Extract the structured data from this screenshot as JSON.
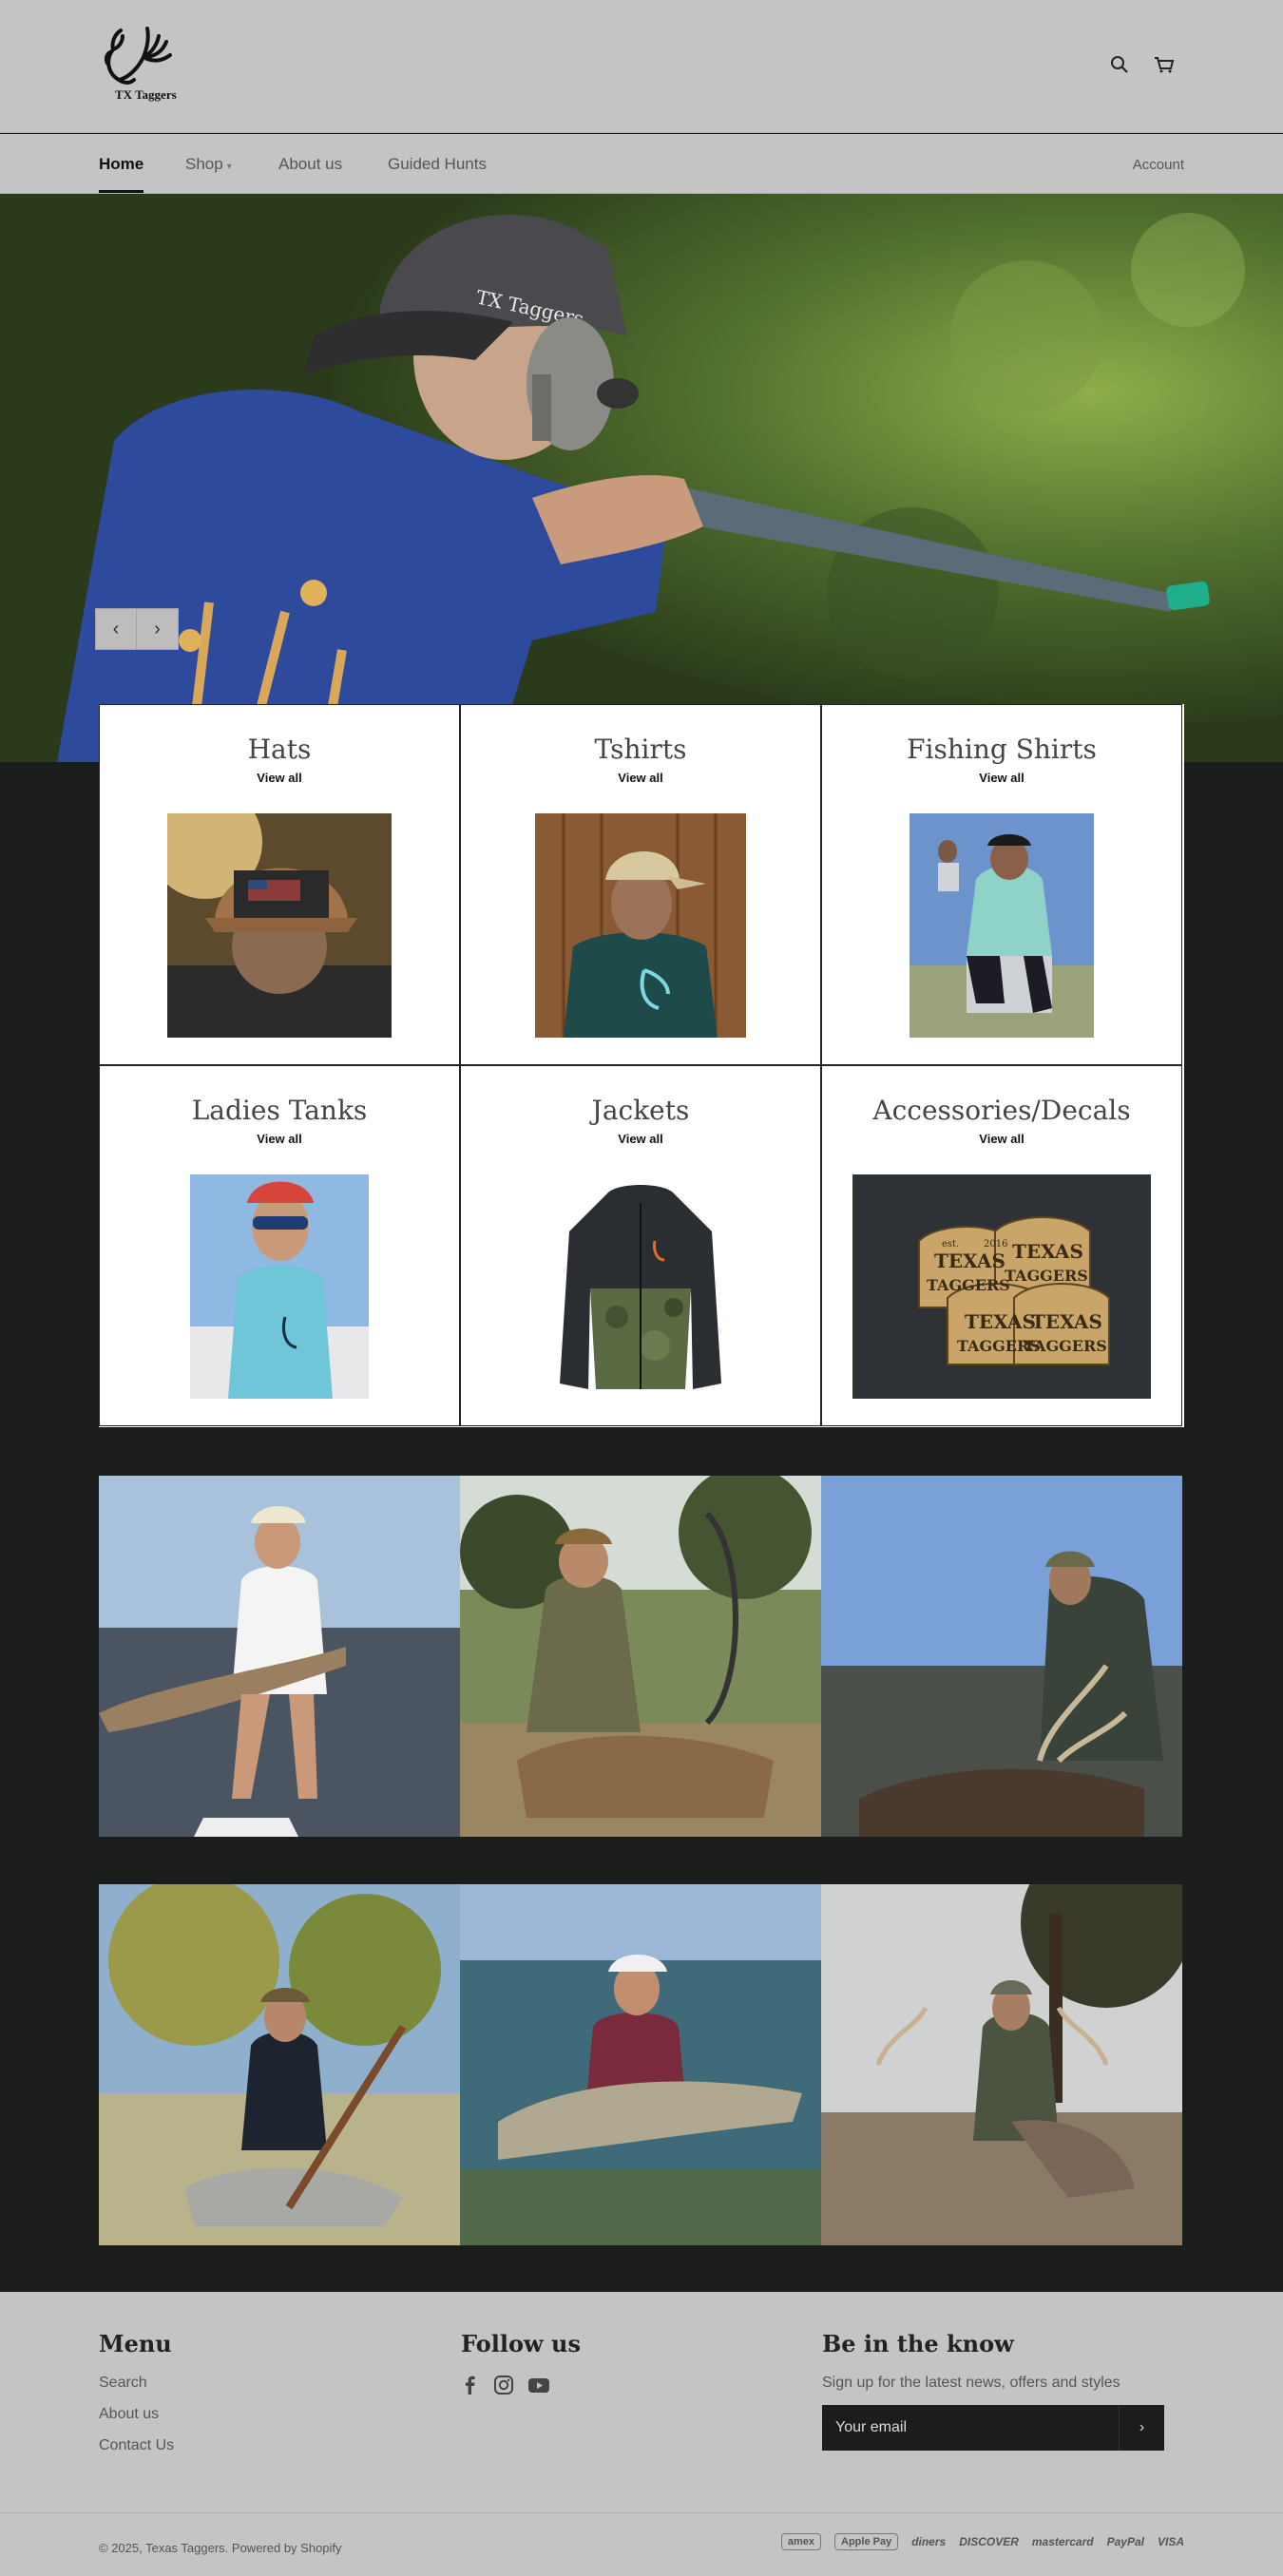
{
  "header": {
    "logo_text": "TX Taggers"
  },
  "nav": {
    "items": [
      {
        "label": "Home",
        "active": true
      },
      {
        "label": "Shop",
        "dropdown": true
      },
      {
        "label": "About us"
      },
      {
        "label": "Guided Hunts"
      }
    ],
    "account": "Account"
  },
  "hero": {
    "cap_text": "TX Taggers",
    "prev": "‹",
    "next": "›"
  },
  "collections": [
    {
      "title": "Hats",
      "link": "View all"
    },
    {
      "title": "Tshirts",
      "link": "View all"
    },
    {
      "title": "Fishing Shirts",
      "link": "View all"
    },
    {
      "title": "Ladies Tanks",
      "link": "View all"
    },
    {
      "title": "Jackets",
      "link": "View all"
    },
    {
      "title": "Accessories/Decals",
      "link": "View all"
    }
  ],
  "decal": {
    "line1": "TEXAS",
    "line2": "TAGGERS",
    "est": "est.",
    "year": "2016"
  },
  "footer": {
    "menu": {
      "title": "Menu",
      "links": [
        "Search",
        "About us",
        "Contact Us"
      ]
    },
    "follow": {
      "title": "Follow us",
      "icons": [
        "facebook-icon",
        "instagram-icon",
        "youtube-icon"
      ]
    },
    "newsletter": {
      "title": "Be in the know",
      "text": "Sign up for the latest news, offers and styles",
      "placeholder": "Your email",
      "submit": "›"
    },
    "copyright": "© 2025, Texas Taggers. Powered by Shopify",
    "payments": [
      "amex",
      "Apple Pay",
      "diners",
      "DISCOVER",
      "mastercard",
      "PayPal",
      "VISA"
    ]
  },
  "colors": {
    "header_bg": "#c4c4c4",
    "page_bg": "#1b1c1c",
    "text_dark": "#111111"
  }
}
